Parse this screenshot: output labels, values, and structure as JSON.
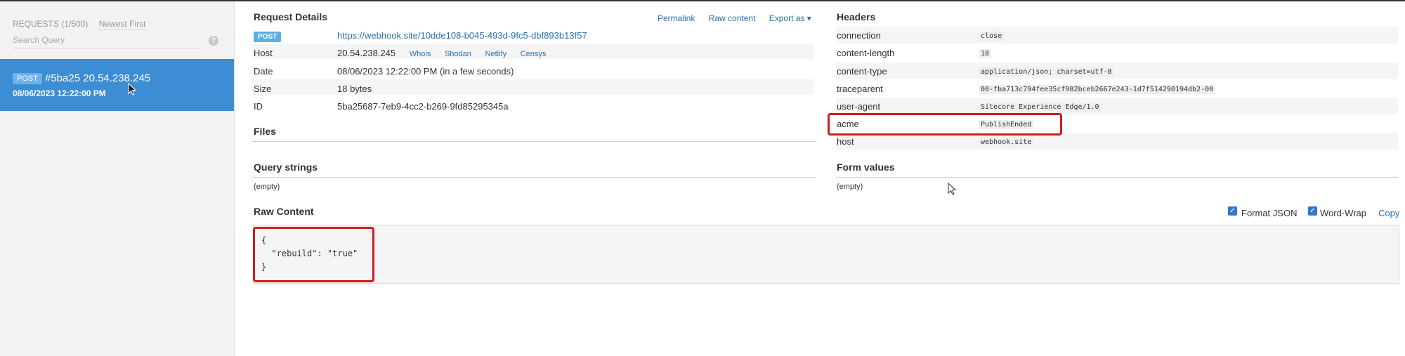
{
  "sidebar": {
    "requests_header": "REQUESTS (1/500)",
    "sort_label": "Newest First",
    "search_placeholder": "Search Query",
    "help_symbol": "?",
    "selected_request": {
      "method": "POST",
      "id_ip": "#5ba25 20.54.238.245",
      "datetime": "08/06/2023 12:22:00 PM"
    }
  },
  "details": {
    "title": "Request Details",
    "actions": [
      "Permalink",
      "Raw content",
      "Export as ▾"
    ],
    "method": "POST",
    "url": "https://webhook.site/10dde108-b045-493d-9fc5-dbf893b13f57",
    "host_label": "Host",
    "host_value": "20.54.238.245",
    "host_links": [
      "Whois",
      "Shodan",
      "Netlify",
      "Censys"
    ],
    "date_label": "Date",
    "date_value": "08/06/2023 12:22:00 PM (in a few seconds)",
    "size_label": "Size",
    "size_value": "18 bytes",
    "id_label": "ID",
    "id_value": "5ba25687-7eb9-4cc2-b269-9fd85295345a",
    "files_title": "Files",
    "query_title": "Query strings",
    "query_value": "(empty)"
  },
  "headers": {
    "title": "Headers",
    "rows": [
      {
        "key": "connection",
        "value": "close"
      },
      {
        "key": "content-length",
        "value": "18"
      },
      {
        "key": "content-type",
        "value": "application/json; charset=utf-8"
      },
      {
        "key": "traceparent",
        "value": "00-fba713c794fee35cf982bceb2667e243-1d7f514290194db2-00"
      },
      {
        "key": "user-agent",
        "value": "Sitecore Experience Edge/1.0"
      },
      {
        "key": "acme",
        "value": "PublishEnded"
      },
      {
        "key": "host",
        "value": "webhook.site"
      }
    ],
    "form_title": "Form values",
    "form_value": "(empty)"
  },
  "raw": {
    "title": "Raw Content",
    "format_json_label": "Format JSON",
    "word_wrap_label": "Word-Wrap",
    "copy_label": "Copy",
    "content": "{\n  \"rebuild\": \"true\"\n}"
  },
  "colors": {
    "accent": "#3c8dd4",
    "highlight": "#cc1f1f"
  }
}
